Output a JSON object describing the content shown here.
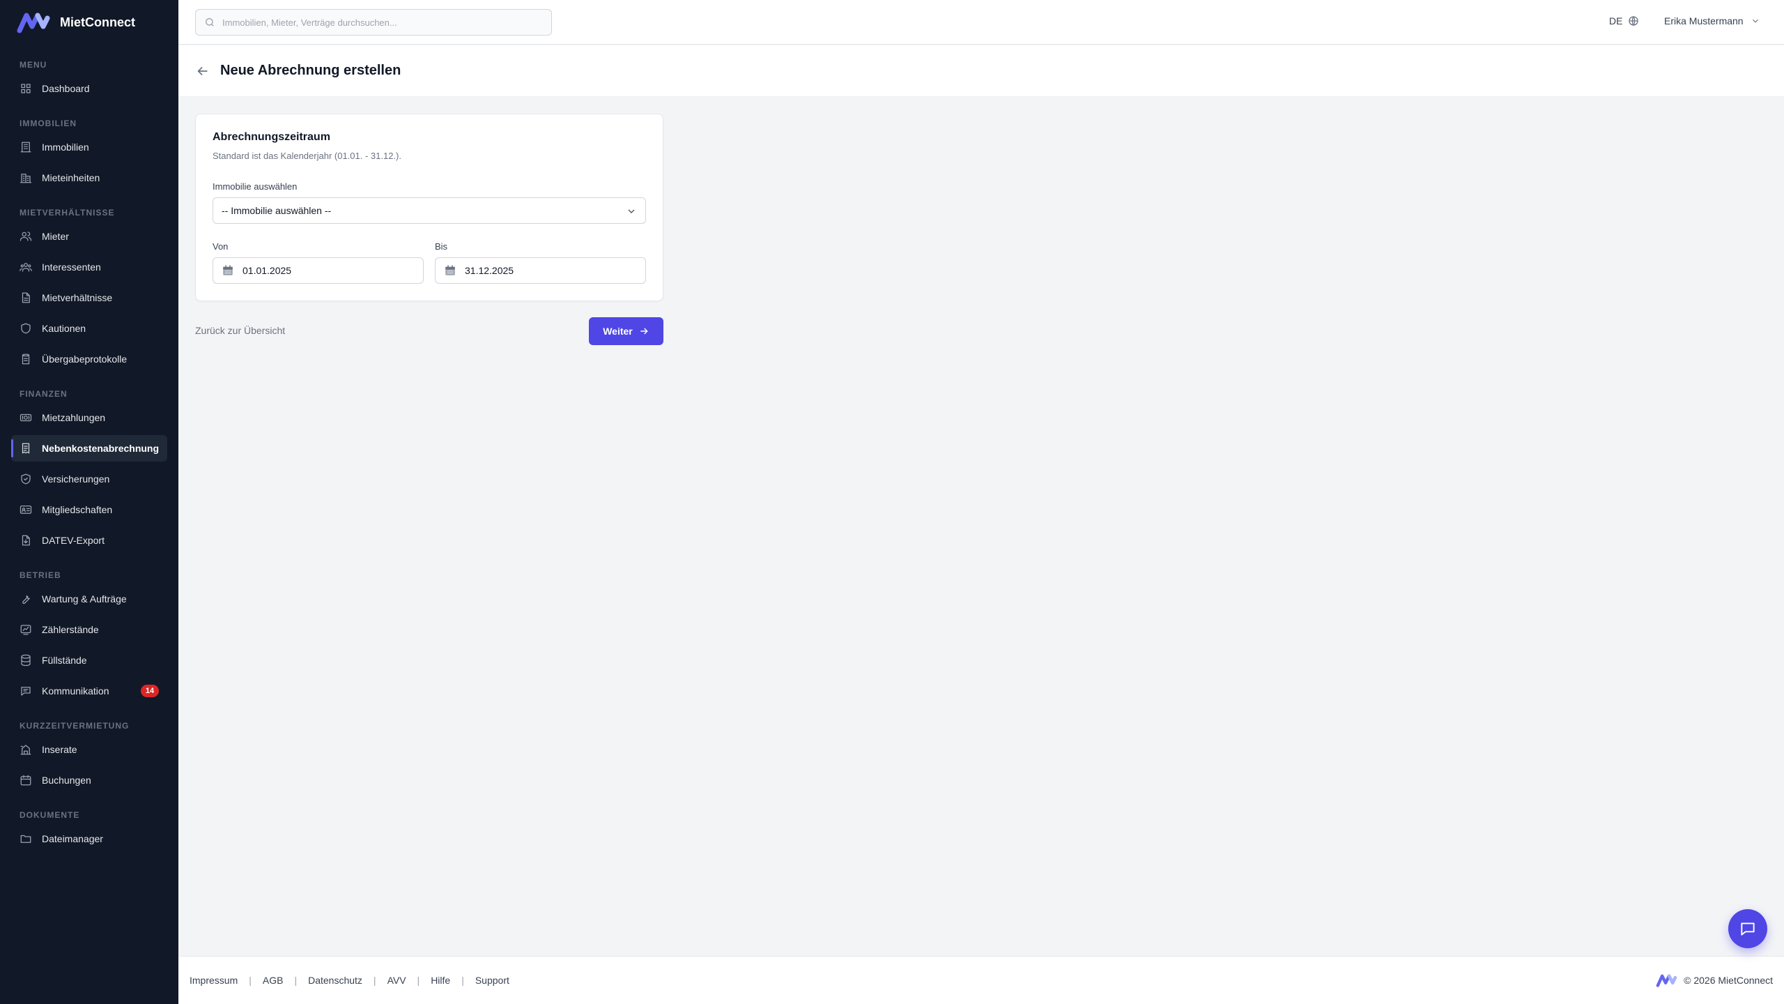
{
  "app": {
    "name": "MietConnect"
  },
  "sidebar": {
    "sections": [
      {
        "title": "MENU",
        "items": [
          {
            "label": "Dashboard",
            "icon": "grid-icon"
          }
        ]
      },
      {
        "title": "IMMOBILIEN",
        "items": [
          {
            "label": "Immobilien",
            "icon": "building-icon"
          },
          {
            "label": "Mieteinheiten",
            "icon": "apartment-icon"
          }
        ]
      },
      {
        "title": "MIETVERHÄLTNISSE",
        "items": [
          {
            "label": "Mieter",
            "icon": "users-icon"
          },
          {
            "label": "Interessenten",
            "icon": "user-group-icon"
          },
          {
            "label": "Mietverhältnisse",
            "icon": "document-icon"
          },
          {
            "label": "Kautionen",
            "icon": "shield-icon"
          },
          {
            "label": "Übergabeprotokolle",
            "icon": "clipboard-icon"
          }
        ]
      },
      {
        "title": "FINANZEN",
        "items": [
          {
            "label": "Mietzahlungen",
            "icon": "banknote-icon"
          },
          {
            "label": "Nebenkostenabrechnung",
            "icon": "receipt-icon",
            "active": true
          },
          {
            "label": "Versicherungen",
            "icon": "shield-check-icon"
          },
          {
            "label": "Mitgliedschaften",
            "icon": "id-card-icon"
          },
          {
            "label": "DATEV-Export",
            "icon": "file-export-icon"
          }
        ]
      },
      {
        "title": "BETRIEB",
        "items": [
          {
            "label": "Wartung & Aufträge",
            "icon": "wrench-icon"
          },
          {
            "label": "Zählerstände",
            "icon": "meter-icon"
          },
          {
            "label": "Füllstände",
            "icon": "database-icon"
          },
          {
            "label": "Kommunikation",
            "icon": "chat-icon",
            "badge": "14"
          }
        ]
      },
      {
        "title": "KURZZEITVERMIETUNG",
        "items": [
          {
            "label": "Inserate",
            "icon": "listing-icon"
          },
          {
            "label": "Buchungen",
            "icon": "calendar-icon"
          }
        ]
      },
      {
        "title": "DOKUMENTE",
        "items": [
          {
            "label": "Dateimanager",
            "icon": "folder-icon"
          }
        ]
      }
    ]
  },
  "topbar": {
    "search_placeholder": "Immobilien, Mieter, Verträge durchsuchen...",
    "language": "DE",
    "user_name": "Erika Mustermann"
  },
  "page": {
    "title": "Neue Abrechnung erstellen"
  },
  "form": {
    "title": "Abrechnungszeitraum",
    "subtitle": "Standard ist das Kalenderjahr (01.01. - 31.12.).",
    "property_label": "Immobilie auswählen",
    "property_value": "-- Immobilie auswählen --",
    "from_label": "Von",
    "from_value": "01.01.2025",
    "to_label": "Bis",
    "to_value": "31.12.2025"
  },
  "actions": {
    "back_label": "Zurück zur Übersicht",
    "next_label": "Weiter"
  },
  "footer": {
    "links": [
      "Impressum",
      "AGB",
      "Datenschutz",
      "AVV",
      "Hilfe",
      "Support"
    ],
    "copyright": "© 2026 MietConnect"
  },
  "colors": {
    "accent": "#4f46e5",
    "sidebar_bg": "#111827",
    "badge": "#dc2626"
  }
}
